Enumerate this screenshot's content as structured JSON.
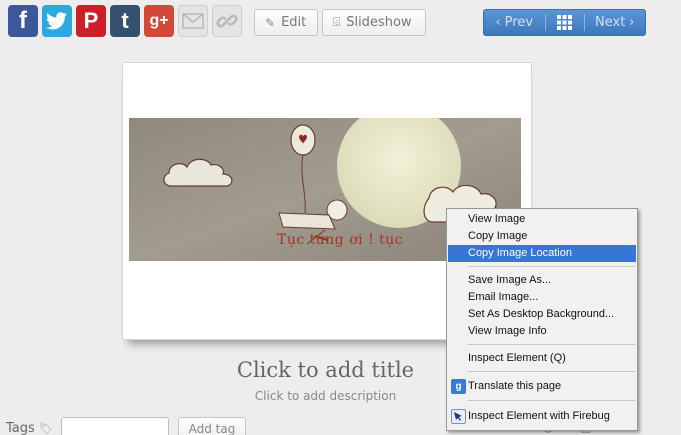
{
  "share": {
    "items": [
      {
        "name": "facebook",
        "glyph": "f"
      },
      {
        "name": "twitter",
        "glyph": ""
      },
      {
        "name": "pinterest",
        "glyph": "P"
      },
      {
        "name": "tumblr",
        "glyph": "t"
      },
      {
        "name": "google-plus",
        "glyph": "g+"
      },
      {
        "name": "email",
        "glyph": ""
      },
      {
        "name": "link",
        "glyph": ""
      }
    ]
  },
  "toolbar": {
    "edit_label": "Edit",
    "slideshow_label": "Slideshow",
    "prev_label": "Prev",
    "next_label": "Next"
  },
  "photo": {
    "caption": "Tục tưng ơi ! tục"
  },
  "content": {
    "title": "Click to add title",
    "description": "Click to add description"
  },
  "tags": {
    "label": "Tags",
    "add_label": "Add tag",
    "input_value": ""
  },
  "context_menu": {
    "view_image": "View Image",
    "copy_image": "Copy Image",
    "copy_image_location": "Copy Image Location",
    "save_image_as": "Save Image As...",
    "email_image": "Email Image...",
    "set_desktop_background": "Set As Desktop Background...",
    "view_image_info": "View Image Info",
    "inspect_element": "Inspect Element (Q)",
    "translate_page": "Translate this page",
    "inspect_firebug": "Inspect Element with Firebug"
  },
  "colors": {
    "pager_blue": "#4a86cc",
    "menu_highlight": "#3875d7",
    "facebook": "#3b5998",
    "twitter": "#2ba9e1",
    "pinterest": "#cb2027",
    "tumblr": "#34526f",
    "google_plus": "#d34836"
  }
}
